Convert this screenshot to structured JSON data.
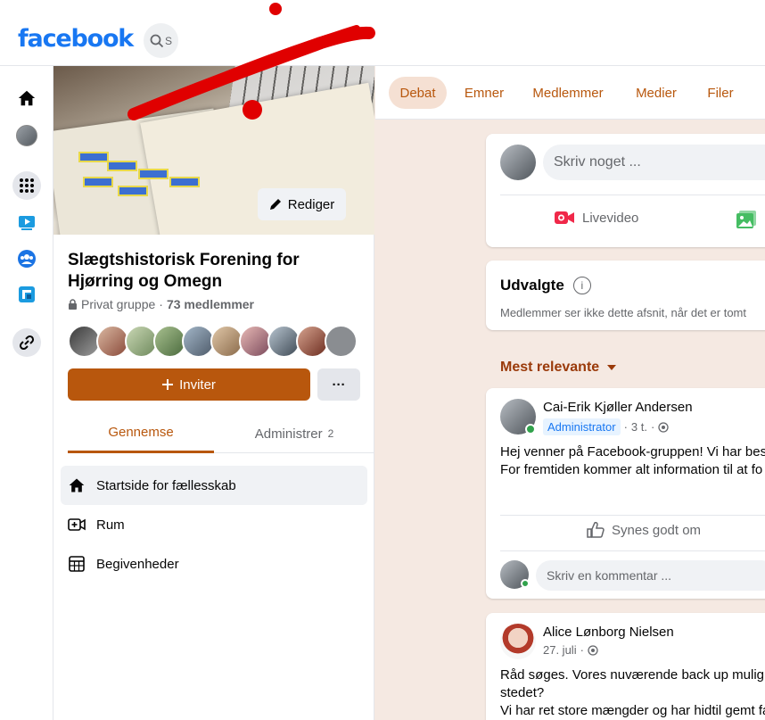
{
  "brand": {
    "logo_text": "facebook",
    "color": "#1877f2",
    "accent": "#b8570d"
  },
  "topbar": {
    "search_placeholder": "S"
  },
  "rail": {
    "items": [
      {
        "icon": "home-icon"
      },
      {
        "icon": "profile-avatar"
      },
      {
        "icon": "menu-grid-icon"
      },
      {
        "icon": "watch-icon"
      },
      {
        "icon": "groups-icon"
      },
      {
        "icon": "gaming-icon"
      },
      {
        "icon": "link-icon"
      }
    ]
  },
  "group": {
    "edit_label": "Rediger",
    "name": "Slægtshistorisk Forening for Hjørring og Omegn",
    "privacy": "Privat gruppe",
    "separator": "·",
    "member_count": "73 medlemmer",
    "invite_label": "Inviter",
    "more_label": "···",
    "tabs": [
      {
        "label": "Gennemse",
        "count": ""
      },
      {
        "label": "Administrer",
        "count": "2"
      }
    ],
    "nav": [
      {
        "label": "Startside for fællesskab",
        "icon": "home-icon"
      },
      {
        "label": "Rum",
        "icon": "video-room-icon"
      },
      {
        "label": "Begivenheder",
        "icon": "calendar-icon"
      }
    ]
  },
  "tabs": [
    "Debat",
    "Emner",
    "Medlemmer",
    "Medier",
    "Filer"
  ],
  "composer": {
    "placeholder": "Skriv noget ...",
    "live_label": "Livevideo"
  },
  "featured": {
    "title": "Udvalgte",
    "subtitle": "Medlemmer ser ikke dette afsnit, når det er tomt"
  },
  "sort_label": "Mest relevante",
  "posts": [
    {
      "author": "Cai-Erik Kjøller Andersen",
      "badge": "Administrator",
      "time": "3 t.",
      "lines": [
        "Hej venner på Facebook-gruppen! Vi har beslu",
        "For fremtiden kommer alt information til at fo"
      ],
      "like_label": "Synes godt om",
      "comment_placeholder": "Skriv en kommentar ..."
    },
    {
      "author": "Alice Lønborg Nielsen",
      "time": "27. juli",
      "lines": [
        "Råd søges. Vores nuværende back up mulighe",
        "stedet?",
        "Vi har ret store mængder og har hidtil gemt fa"
      ]
    }
  ]
}
